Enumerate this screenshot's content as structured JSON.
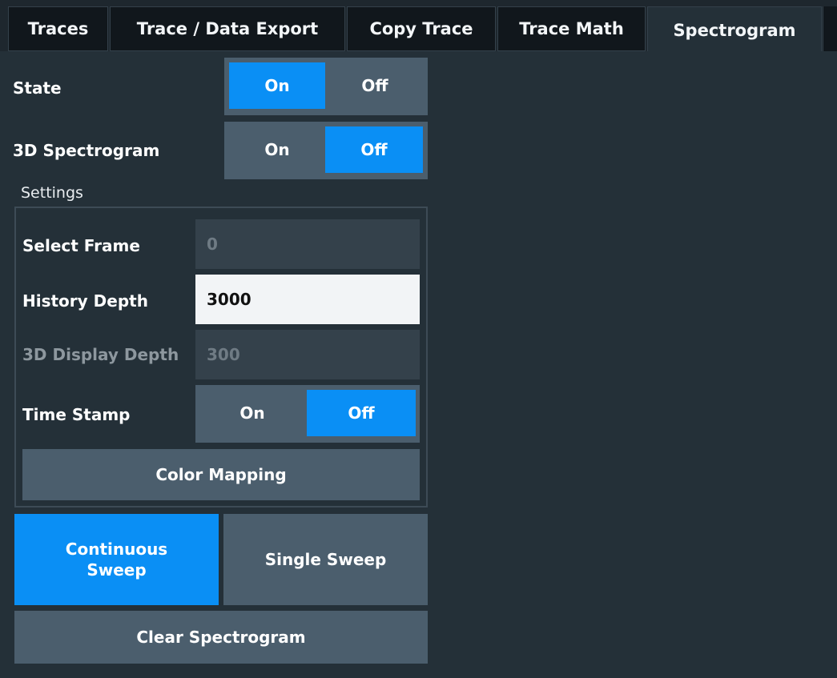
{
  "tabs": [
    {
      "label": "Traces"
    },
    {
      "label": "Trace / Data Export"
    },
    {
      "label": "Copy Trace"
    },
    {
      "label": "Trace Math"
    },
    {
      "label": "Spectrogram",
      "active": true
    }
  ],
  "state": {
    "label": "State",
    "on": "On",
    "off": "Off",
    "selected": "On"
  },
  "spectrogram3d": {
    "label": "3D Spectrogram",
    "on": "On",
    "off": "Off",
    "selected": "Off"
  },
  "settings": {
    "title": "Settings",
    "select_frame": {
      "label": "Select Frame",
      "value": "0"
    },
    "history_depth": {
      "label": "History Depth",
      "value": "3000"
    },
    "display_depth_3d": {
      "label": "3D Display Depth",
      "value": "300"
    },
    "time_stamp": {
      "label": "Time Stamp",
      "on": "On",
      "off": "Off",
      "selected": "Off"
    },
    "color_mapping": "Color Mapping"
  },
  "sweep": {
    "continuous_line1": "Continuous",
    "continuous_line2": "Sweep",
    "single": "Single Sweep",
    "selected": "Continuous Sweep"
  },
  "clear": "Clear Spectrogram",
  "colors": {
    "accent": "#0a8ff5",
    "button": "#4b5e6d",
    "panel": "#243038"
  }
}
